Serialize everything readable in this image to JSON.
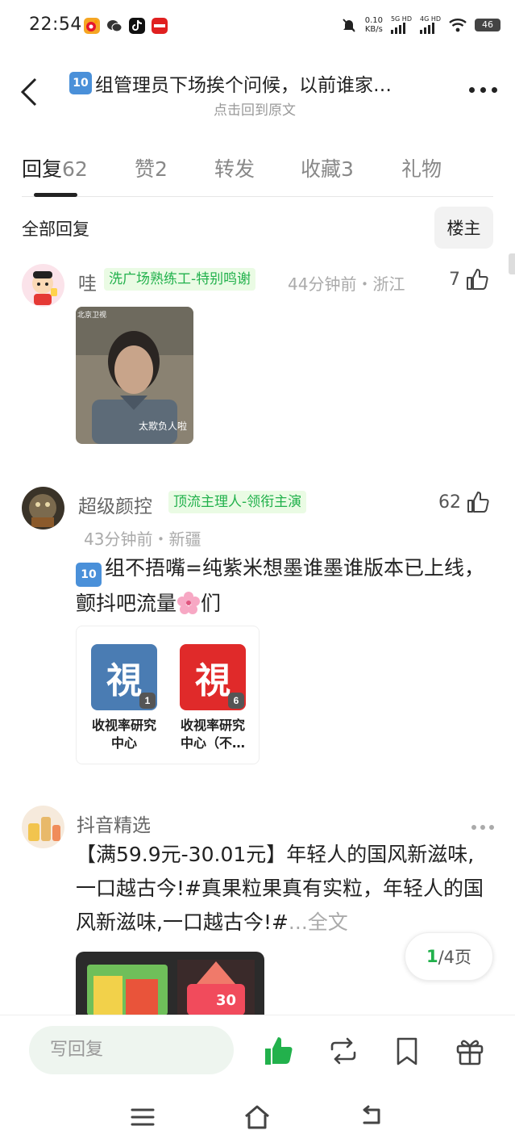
{
  "status_bar": {
    "time": "22:54",
    "net_speed_value": "0.10",
    "net_speed_unit": "KB/s",
    "sim1": "5G HD",
    "sim2": "4G HD",
    "battery": "46"
  },
  "header": {
    "title": "组管理员下场挨个问候，以前谁家…",
    "title_badge": "10",
    "subtitle": "点击回到原文"
  },
  "tabs": [
    {
      "label": "回复",
      "count": "62"
    },
    {
      "label": "赞",
      "count": "2"
    },
    {
      "label": "转发",
      "count": ""
    },
    {
      "label": "收藏",
      "count": "3"
    },
    {
      "label": "礼物",
      "count": ""
    }
  ],
  "section": {
    "all_replies": "全部回复",
    "owner_button": "楼主"
  },
  "comments": [
    {
      "user": "哇",
      "tag": "洗广场熟练工-特别鸣谢",
      "meta": "44分钟前・浙江",
      "likes": "7",
      "image_caption": "太欺负人啦",
      "image_watermark": "北京卫视"
    },
    {
      "user": "超级颜控",
      "tag": "顶流主理人-领衔主演",
      "meta": "43分钟前・新疆",
      "likes": "62",
      "text": "组不捂嘴=纯紫米想墨谁墨谁版本已上线，颤抖吧流量",
      "text_tail": "们",
      "text_badge": "10",
      "cards": [
        {
          "logo": "視",
          "count": "1",
          "label": "收视率研究中心"
        },
        {
          "logo": "視",
          "count": "6",
          "label": "收视率研究中心（不…"
        }
      ]
    },
    {
      "user": "抖音精选",
      "text": "【满59.9元-30.01元】年轻人的国风新滋味,一口越古今!#真果粒果真有实粒，年轻人的国风新滋味,一口越古今!#",
      "ellipsis": "...",
      "fulltext": "全文",
      "ad_price": "30"
    }
  ],
  "pagination": {
    "current": "1",
    "total": "/4页"
  },
  "bottom_bar": {
    "reply_placeholder": "写回复"
  },
  "colors": {
    "accent_green": "#22b14c",
    "tag_bg": "#eafbe4"
  }
}
